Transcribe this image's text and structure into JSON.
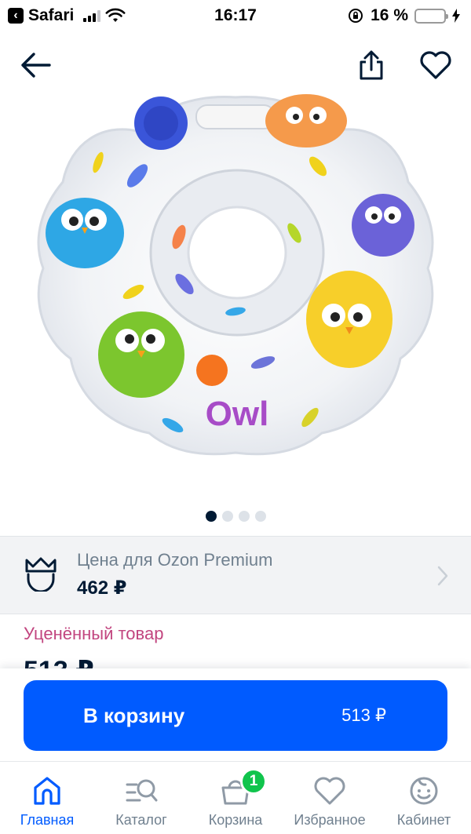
{
  "status_bar": {
    "back_app": "Safari",
    "time": "16:17",
    "battery_text": "16 %",
    "battery_level": 0.16
  },
  "product": {
    "image_text": "Owl",
    "gallery_total": 4,
    "gallery_active": 1
  },
  "premium": {
    "title": "Цена для Ozon Premium",
    "price": "462 ₽"
  },
  "discount_label": "Уценённый товар",
  "price_partial": "513 ₽",
  "cart_button": {
    "label": "В корзину",
    "price": "513 ₽"
  },
  "tabs": [
    {
      "label": "Главная",
      "icon": "home-icon",
      "active": true
    },
    {
      "label": "Каталог",
      "icon": "catalog-search-icon"
    },
    {
      "label": "Корзина",
      "icon": "cart-icon",
      "badge": "1"
    },
    {
      "label": "Избранное",
      "icon": "heart-icon"
    },
    {
      "label": "Кабинет",
      "icon": "profile-icon"
    }
  ],
  "colors": {
    "accent": "#005bff",
    "text": "#001a34",
    "muted": "#70808f",
    "discount": "#c2457f",
    "badge": "#10c44c"
  }
}
